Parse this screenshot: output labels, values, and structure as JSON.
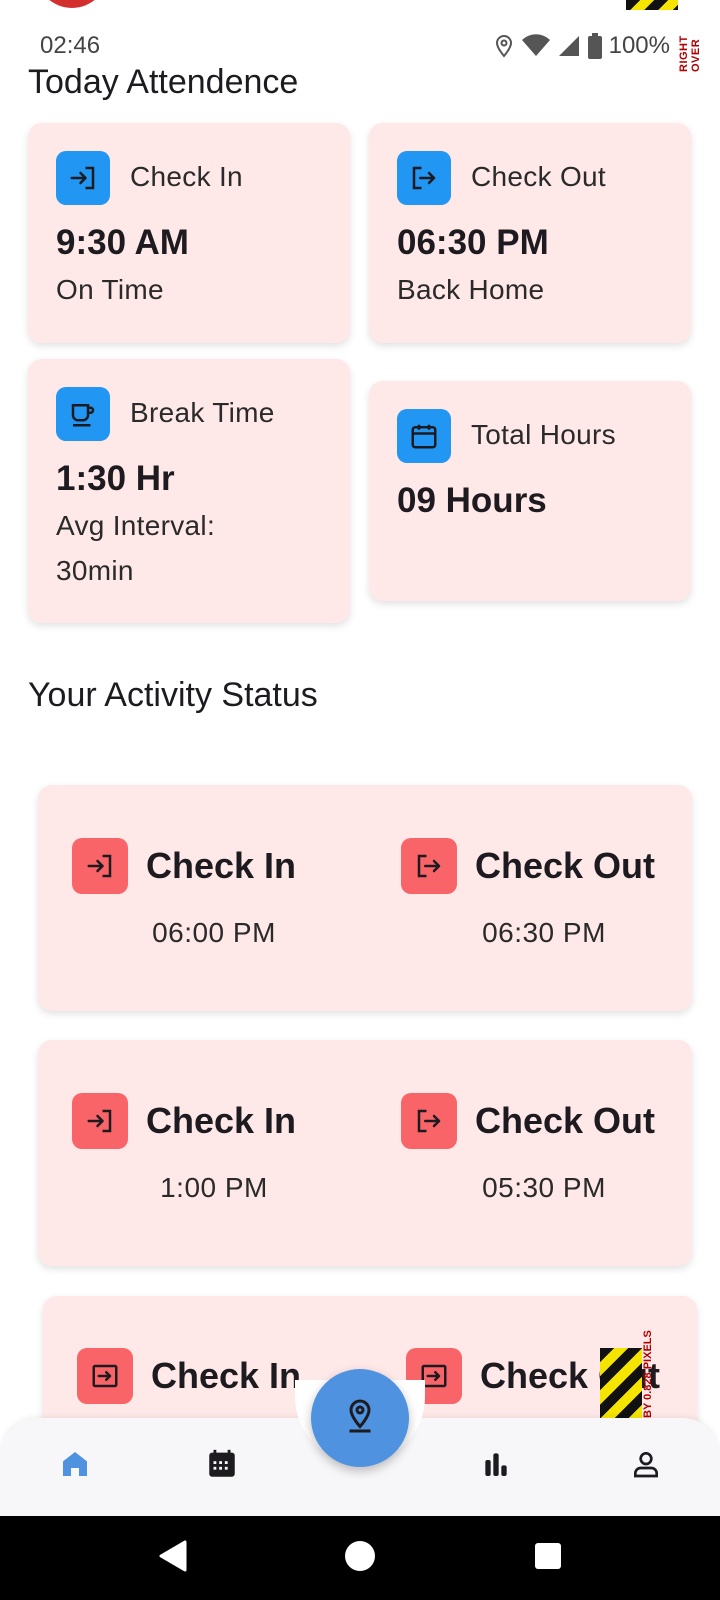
{
  "status_bar": {
    "time": "02:46",
    "battery": "100%"
  },
  "overlay": {
    "top_text": "RIGHT OVER",
    "bottom_text": "BY 0.828 PIXELS"
  },
  "today": {
    "title": "Today Attendence",
    "cards": [
      {
        "icon": "login-icon",
        "label": "Check In",
        "value": "9:30 AM",
        "sub": "On Time"
      },
      {
        "icon": "logout-icon",
        "label": "Check Out",
        "value": "06:30 PM",
        "sub": "Back Home"
      },
      {
        "icon": "coffee-icon",
        "label": "Break Time",
        "value": "1:30 Hr",
        "sub_line1": "Avg Interval:",
        "sub_line2": "30min"
      },
      {
        "icon": "calendar-icon",
        "label": "Total Hours",
        "value": "09 Hours"
      }
    ]
  },
  "activity": {
    "title": "Your Activity Status",
    "rows": [
      {
        "in_label": "Check In",
        "in_time": "06:00 PM",
        "out_label": "Check Out",
        "out_time": "06:30 PM"
      },
      {
        "in_label": "Check In",
        "in_time": "1:00 PM",
        "out_label": "Check Out",
        "out_time": "05:30 PM"
      },
      {
        "in_label": "Check In",
        "out_label": "Check Out"
      }
    ]
  },
  "bottom_nav": {
    "items": [
      "home-icon",
      "calendar-icon",
      "bar-chart-icon",
      "profile-icon"
    ],
    "fab_icon": "location-pin-icon",
    "active_color": "#4f92e0"
  },
  "colors": {
    "card_bg": "#ffe8e8",
    "blue_icon": "#2196f3",
    "red_icon": "#f86468"
  }
}
